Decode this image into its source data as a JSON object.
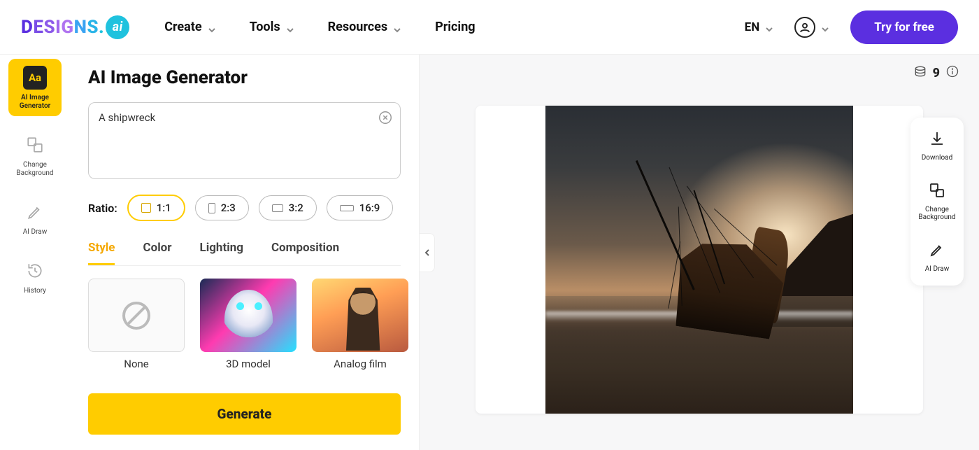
{
  "logo_text": "DESIGNS.",
  "logo_badge": "ai",
  "nav": {
    "create": "Create",
    "tools": "Tools",
    "resources": "Resources",
    "pricing": "Pricing"
  },
  "lang": "EN",
  "cta": "Try for free",
  "sidebar": {
    "ai_image": "AI Image Generator",
    "change_bg": "Change Background",
    "ai_draw": "AI Draw",
    "history": "History"
  },
  "page_title": "AI Image Generator",
  "prompt_value": "A shipwreck",
  "ratio_label": "Ratio:",
  "ratios": {
    "r11": "1:1",
    "r23": "2:3",
    "r32": "3:2",
    "r169": "16:9"
  },
  "tabs": {
    "style": "Style",
    "color": "Color",
    "lighting": "Lighting",
    "composition": "Composition"
  },
  "styles": {
    "none": "None",
    "threeD": "3D model",
    "analog": "Analog film"
  },
  "generate": "Generate",
  "credits": "9",
  "rail": {
    "download": "Download",
    "change_bg": "Change Background",
    "ai_draw": "AI Draw"
  }
}
